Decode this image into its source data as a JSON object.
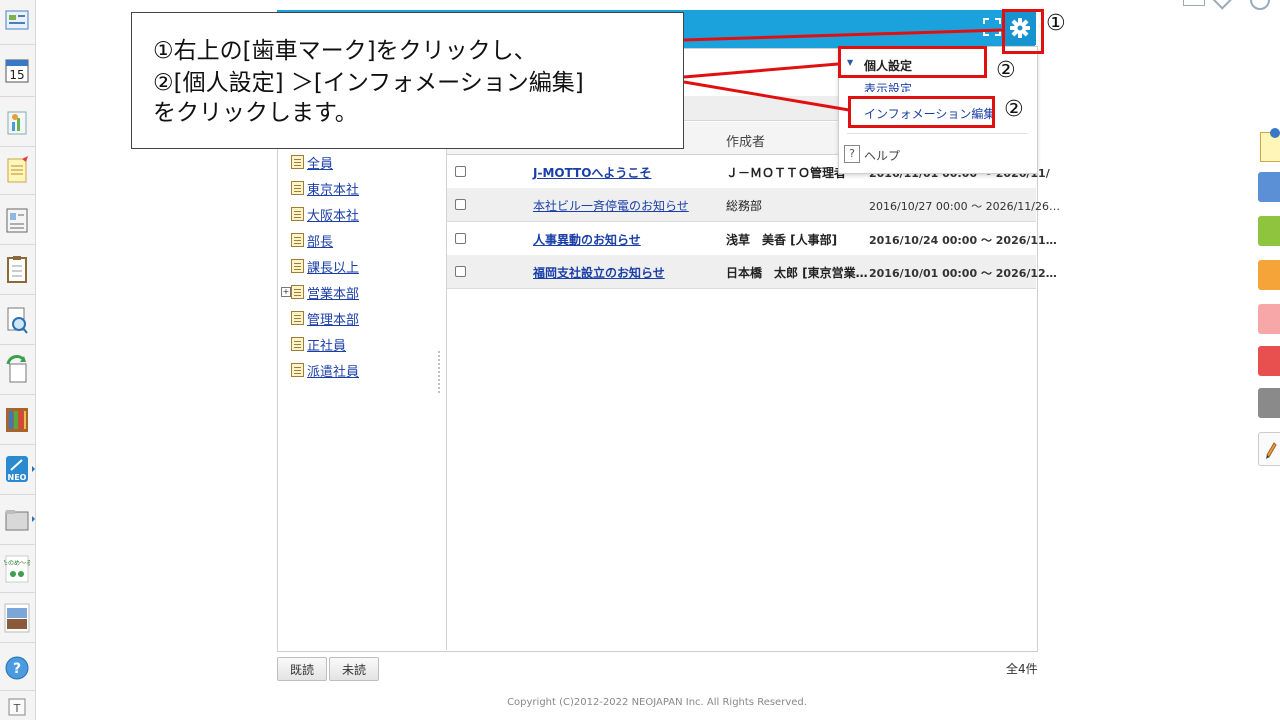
{
  "rail_icons": [
    "portal-icon",
    "calendar-icon",
    "chart-icon",
    "memo-icon",
    "contacts-icon",
    "clipboard-icon",
    "search-doc-icon",
    "recycle-icon",
    "bookshelf-icon",
    "neo-icon",
    "folder-icon",
    "tanomail-icon",
    "photo-icon",
    "help-icon",
    "text-icon"
  ],
  "calendar_day": "15",
  "tree": {
    "items": [
      "全員",
      "東京本社",
      "大阪本社",
      "部長",
      "課長以上",
      "営業本部",
      "管理本部",
      "正社員",
      "派遣社員"
    ]
  },
  "list": {
    "author_header": "作成者",
    "rows": [
      {
        "title": "J-MOTTOへようこそ",
        "author": "Ｊ－ＭＯＴＴＯ管理者",
        "period": "2016/11/01 00:00 ～ 2026/11/",
        "bold": true
      },
      {
        "title": "本社ビル一斉停電のお知らせ",
        "author": "総務部",
        "period": "2016/10/27 00:00 ～ 2026/11/26…",
        "bold": false
      },
      {
        "title": "人事異動のお知らせ",
        "author": "浅草　美香 [人事部]",
        "period": "2016/10/24 00:00 ～ 2026/11…",
        "bold": true
      },
      {
        "title": "福岡支社設立のお知らせ",
        "author": "日本橋　太郎 [東京営業…",
        "period": "2016/10/01 00:00 ～ 2026/12…",
        "bold": true
      }
    ]
  },
  "dropdown": {
    "personal_settings": "個人設定",
    "display_settings": "表示設定",
    "info_edit": "インフォメーション編集",
    "help": "ヘルプ"
  },
  "buttons": {
    "read": "既読",
    "unread": "未読"
  },
  "total": "全4件",
  "copyright": "Copyright (C)2012-2022 NEOJAPAN Inc. All Rights Reserved.",
  "callout": {
    "line1": "①右上の[歯車マーク]をクリックし、",
    "line2": "②[個人設定] ＞[インフォメーション編集]",
    "line3": "をクリックします。"
  },
  "markers": {
    "one": "①",
    "two_a": "②",
    "two_b": "②"
  },
  "colors": {
    "header": "#1ba2dd",
    "highlight": "#e01010",
    "link": "#1a3fa8"
  },
  "right_tabs": [
    "#5b8fd6",
    "#8fc43f",
    "#f5a43a",
    "#f7a7a7",
    "#e85050",
    "#8a8a8a"
  ]
}
